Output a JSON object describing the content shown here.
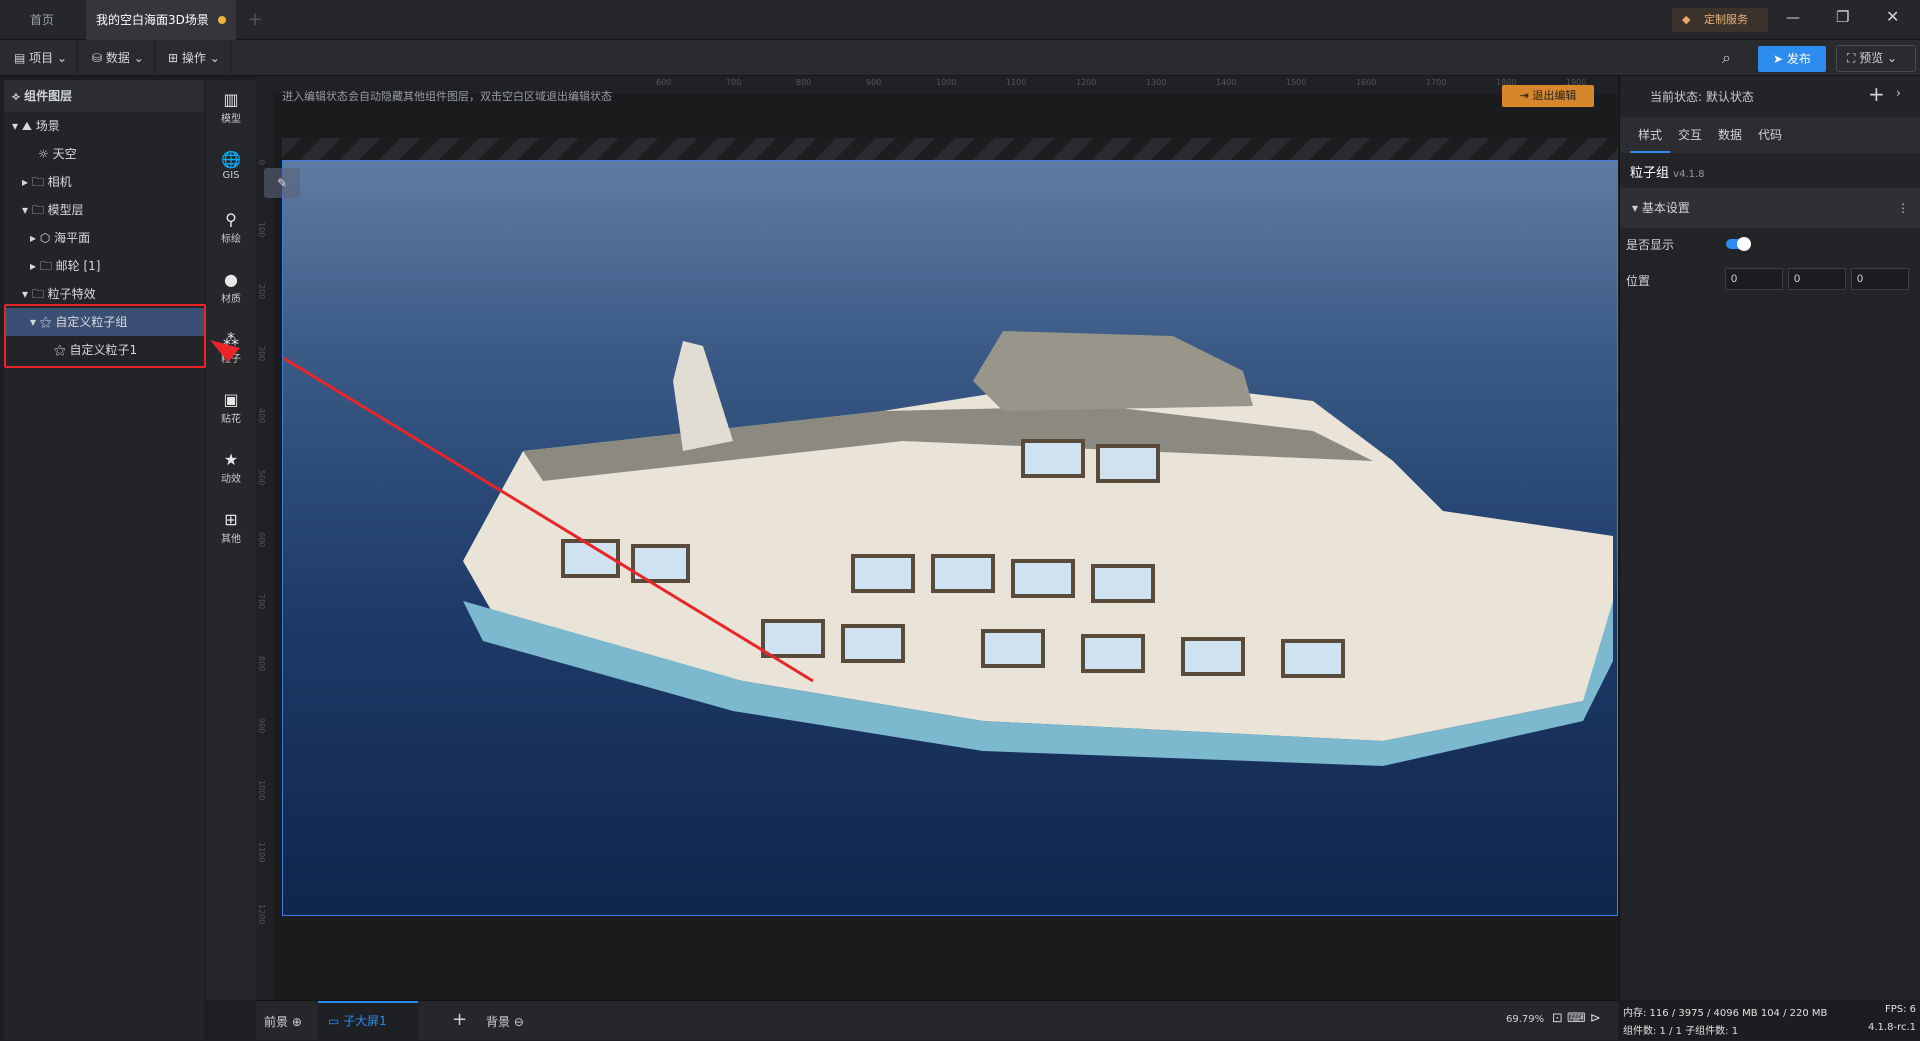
{
  "tabs": [
    {
      "label": "首页"
    },
    {
      "label": "我的空白海面3D场景"
    }
  ],
  "title_right": {
    "service": "定制服务"
  },
  "toolbar": {
    "project": "项目",
    "data": "数据",
    "operate": "操作",
    "publish": "发布",
    "preview": "预览"
  },
  "layers": {
    "title": "组件图层",
    "items": [
      {
        "label": "场景"
      },
      {
        "label": "天空"
      },
      {
        "label": "相机"
      },
      {
        "label": "模型层"
      },
      {
        "label": "海平面"
      },
      {
        "label": "邮轮 [1]"
      },
      {
        "label": "粒子特效"
      },
      {
        "label": "自定义粒子组"
      },
      {
        "label": "自定义粒子1"
      }
    ]
  },
  "iconbar": [
    {
      "label": "模型"
    },
    {
      "label": "GIS"
    },
    {
      "label": "标绘"
    },
    {
      "label": "材质"
    },
    {
      "label": "粒子"
    },
    {
      "label": "贴花"
    },
    {
      "label": "动效"
    },
    {
      "label": "其他"
    }
  ],
  "canvas": {
    "hint": "进入编辑状态会自动隐藏其他组件图层，双击空白区域退出编辑状态",
    "exit_edit": "退出编辑",
    "ruler_top": [
      "600",
      "700",
      "800",
      "900",
      "1000",
      "1100",
      "1200",
      "1300",
      "1400",
      "1500",
      "1600",
      "1700",
      "1800",
      "1900"
    ],
    "ruler_left": [
      "0",
      "100",
      "200",
      "300",
      "400",
      "500",
      "600",
      "700",
      "800",
      "900",
      "1000",
      "1100",
      "1200"
    ]
  },
  "bottom": {
    "front": "前景",
    "screen": "子大屏1",
    "back": "背景",
    "zoom": "69.79%"
  },
  "status": {
    "memory": "内存: 116 / 3975 / 4096 MB 104 / 220 MB",
    "fps": "FPS: 6",
    "components": "组件数: 1 / 1   子组件数: 1",
    "version": "4.1.8-rc.1"
  },
  "right": {
    "state_label": "当前状态:",
    "state_value": "默认状态",
    "tabs": [
      "样式",
      "交互",
      "数据",
      "代码"
    ],
    "component": "粒子组",
    "version": "v4.1.8",
    "section": "基本设置",
    "visible_label": "是否显示",
    "visible": true,
    "position_label": "位置",
    "position": [
      "0",
      "0",
      "0"
    ]
  },
  "colors": {
    "accent": "#2d8cf0",
    "annotation": "#e8262a",
    "exit": "#d6872b"
  }
}
